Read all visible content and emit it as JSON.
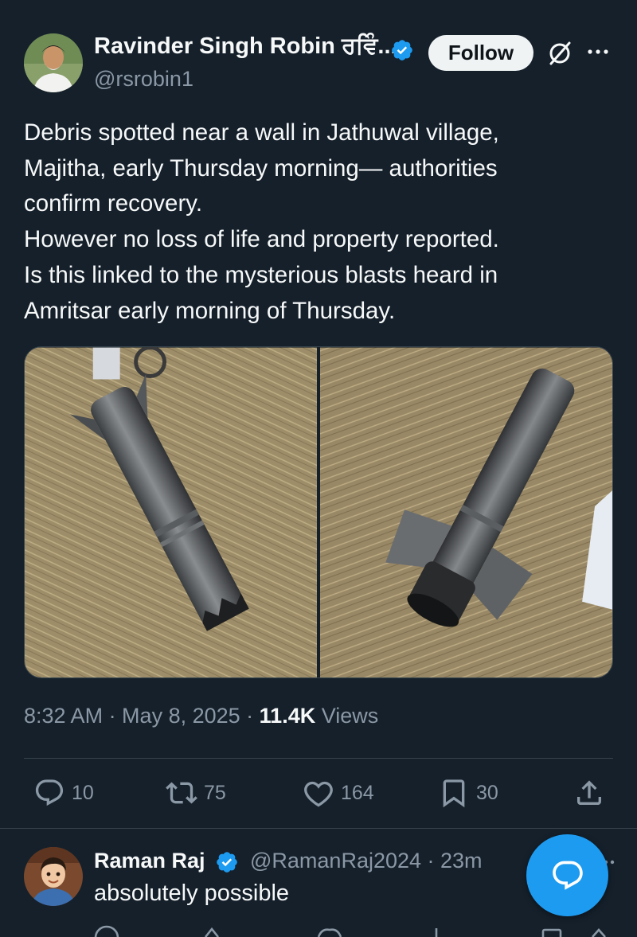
{
  "tweet": {
    "author_name": "Ravinder Singh Robin ਰਵਿੰ...",
    "author_handle": "@rsrobin1",
    "follow_label": "Follow",
    "text_lines": [
      "Debris spotted near a wall in Jathuwal village,",
      "Majitha, early Thursday morning— authorities",
      "confirm recovery.",
      "However no loss of life and property reported.",
      "Is this linked to the mysterious blasts heard in",
      "Amritsar early morning of Thursday."
    ],
    "timestamp": "8:32 AM · May 8, 2025 · ",
    "views_count": "11.4K",
    "views_label": " Views",
    "stats": {
      "replies": "10",
      "retweets": "75",
      "likes": "164",
      "bookmarks": "30"
    }
  },
  "reply": {
    "author_name": "Raman Raj",
    "author_handle_time": "@RamanRaj2024 · 23m",
    "text": "absolutely possible"
  },
  "icons": {
    "verified": "verified-badge-icon",
    "grok": "grok-icon",
    "more": "more-icon",
    "reply": "reply-icon",
    "retweet": "retweet-icon",
    "like": "heart-icon",
    "bookmark": "bookmark-icon",
    "share": "share-icon",
    "fab": "compose-reply-icon"
  },
  "colors": {
    "background": "#15202b",
    "accent": "#1d9bf0",
    "muted_text": "#8b98a5",
    "border": "#38444d"
  }
}
